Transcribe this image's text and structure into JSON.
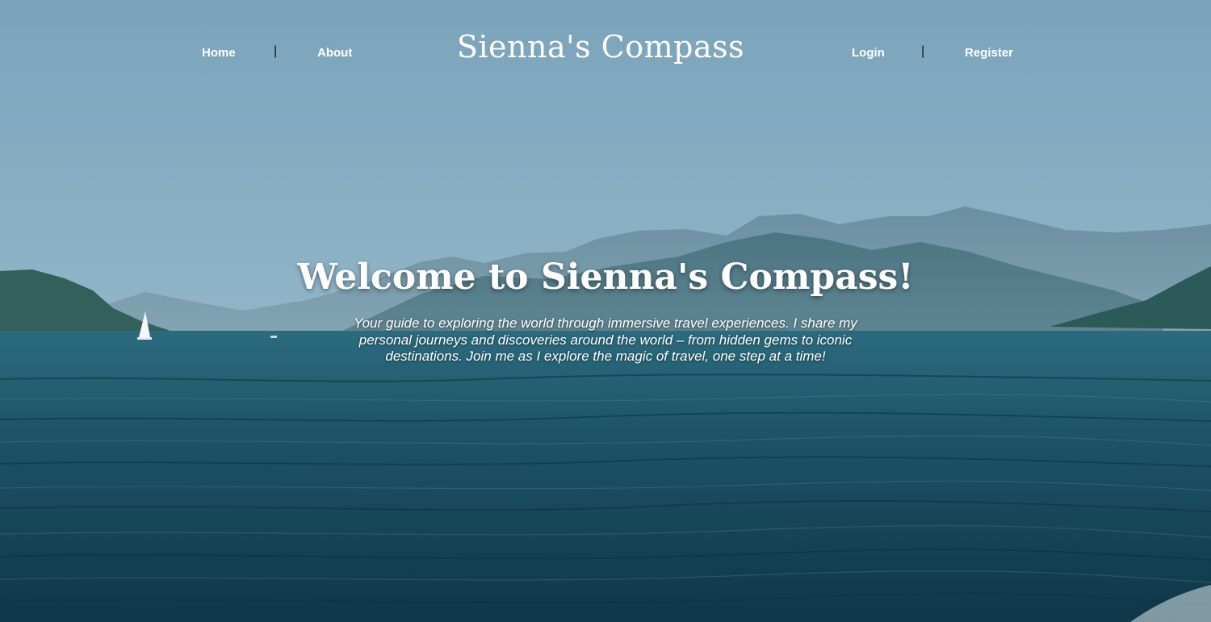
{
  "colors": {
    "sky_top": "#7fa7bd",
    "sky_bottom": "#a6c3d3",
    "sea_top": "#2e6d80",
    "sea_bottom": "#0f3a4c",
    "mountain_far": "#6f94a6",
    "mountain_near": "#3f6b78",
    "hill_dark": "#2e5a56",
    "text": "#ffffff",
    "separator": "#111111"
  },
  "header": {
    "nav_left": [
      {
        "label": "Home"
      },
      {
        "label": "About"
      }
    ],
    "brand": "Sienna's Compass",
    "nav_right": [
      {
        "label": "Login"
      },
      {
        "label": "Register"
      }
    ],
    "separator": "|"
  },
  "hero": {
    "title": "Welcome to Sienna's Compass!",
    "tagline": "Your guide to exploring the world through immersive travel experiences. I share my personal journeys and discoveries around the world – from hidden gems to iconic destinations. Join me as I explore the magic of travel, one step at a time!",
    "background_icon": "sea-landscape"
  }
}
